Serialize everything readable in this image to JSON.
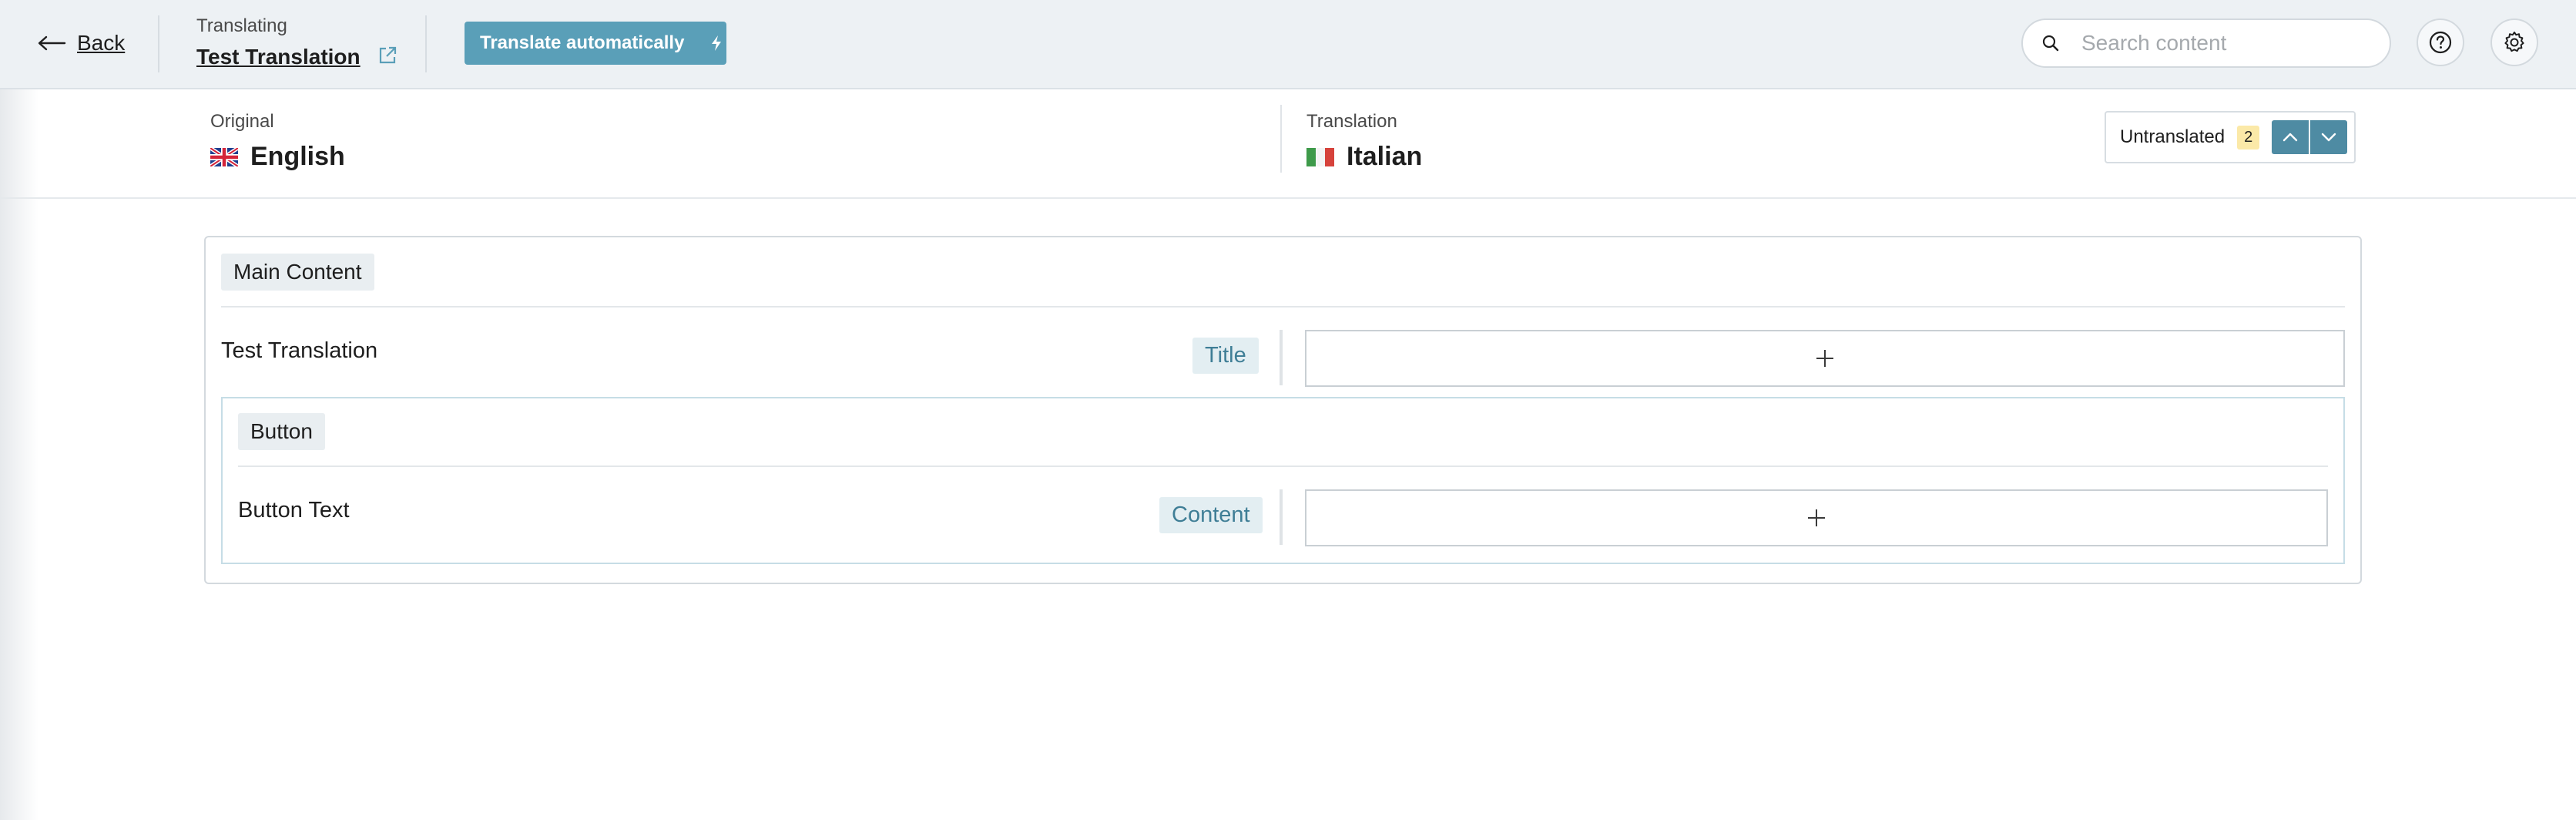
{
  "header": {
    "back_label": "Back",
    "translating_label": "Translating",
    "document_title": "Test Translation",
    "auto_translate_label": "Translate automatically",
    "search_placeholder": "Search content",
    "icons": {
      "back": "arrow-left-icon",
      "external": "external-link-icon",
      "auto": "lightning-icon",
      "search": "search-icon",
      "help": "help-icon",
      "settings": "gear-icon"
    }
  },
  "languages": {
    "original": {
      "label": "Original",
      "name": "English",
      "flag": "uk-flag-icon"
    },
    "translation": {
      "label": "Translation",
      "name": "Italian",
      "flag": "italy-flag-icon"
    }
  },
  "untranslated": {
    "label": "Untranslated",
    "count": "2"
  },
  "content": {
    "group_title": "Main Content",
    "fields": [
      {
        "label": "Test Translation",
        "type": "Title"
      }
    ],
    "subgroup": {
      "title": "Button",
      "fields": [
        {
          "label": "Button Text",
          "type": "Content"
        }
      ]
    }
  },
  "colors": {
    "header_bg": "#edf1f4",
    "accent": "#5a9fb8",
    "nav_button": "#4e8ba3",
    "badge": "#fbe9a8",
    "type_tag_text": "#3f7e96"
  }
}
